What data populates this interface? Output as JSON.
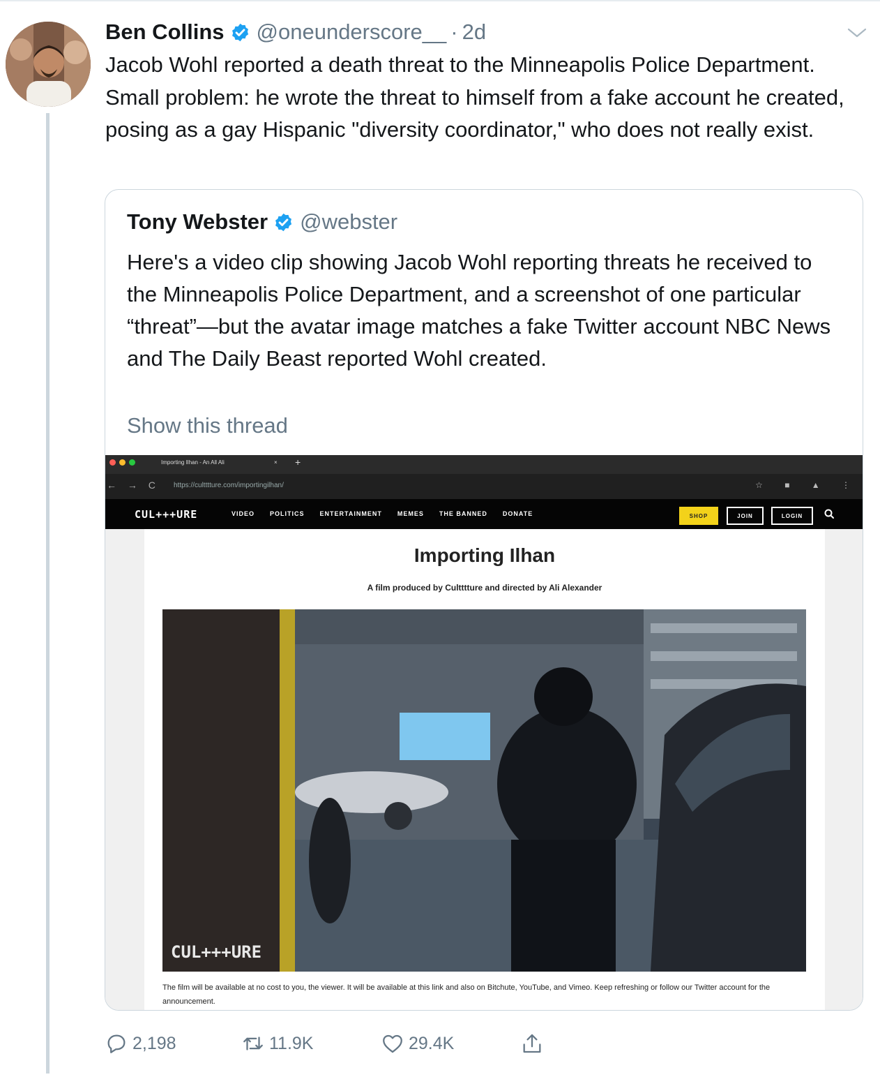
{
  "tweet": {
    "author_name": "Ben Collins",
    "author_handle": "@oneunderscore__",
    "separator": "·",
    "time": "2d",
    "text": "Jacob Wohl reported a death threat to the Minneapolis Police Department. Small problem: he wrote the threat to himself from a fake account he created, posing as a gay Hispanic \"diversity coordinator,\" who does not really exist."
  },
  "quote": {
    "author_name": "Tony Webster",
    "author_handle": "@webster",
    "text": "Here's a video clip showing Jacob Wohl reporting threats he received to the Minneapolis Police Department, and a screenshot of one particular “threat”—but the avatar image matches a fake Twitter account NBC News and The Daily Beast reported Wohl created.",
    "show_thread": "Show this thread"
  },
  "media": {
    "browser": {
      "tab_title": "Importing Ilhan - An All Ali",
      "tab_close": "×",
      "tab_new": "+",
      "nav": "← → C",
      "url": "https://cultttture.com/importingilhan/",
      "icons": "☆ ■ ▲ ⋮"
    },
    "site": {
      "logo": "CUL+++URE",
      "nav_links": [
        "VIDEO",
        "POLITICS",
        "ENTERTAINMENT",
        "MEMES",
        "THE BANNED",
        "DONATE"
      ],
      "shop": "SHOP",
      "join": "JOIN",
      "login": "LOGIN"
    },
    "film_title": "Importing Ilhan",
    "film_subtitle": "A film produced by Cultttture and directed by Ali Alexander",
    "video_logo": "CUL+++URE",
    "film_note": "The film will be available at no cost to you, the viewer. It will be available at this link and also on Bitchute, YouTube, and Vimeo. Keep refreshing or follow our Twitter account for the announcement."
  },
  "actions": {
    "replies": "2,198",
    "retweets": "11.9K",
    "likes": "29.4K"
  },
  "icons": {
    "verified": "verified-badge-icon",
    "chevron": "chevron-down-icon",
    "reply": "reply-icon",
    "retweet": "retweet-icon",
    "like": "heart-icon",
    "share": "share-icon"
  },
  "colors": {
    "verified_blue": "#1da1f2",
    "secondary_text": "#657786",
    "border": "#ccd6dd",
    "shop_yellow": "#f3d21a"
  }
}
